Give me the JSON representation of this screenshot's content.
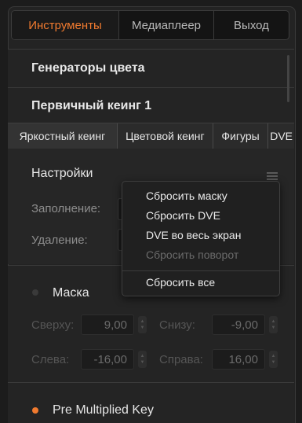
{
  "tabs": [
    "Инструменты",
    "Медиаплеер",
    "Выход"
  ],
  "sections": {
    "color_generators": "Генераторы цвета",
    "upstream_key": "Первичный кеинг 1"
  },
  "key_tabs": [
    "Яркостный кеинг",
    "Цветовой кеинг",
    "Фигуры",
    "DVE"
  ],
  "settings": {
    "title": "Настройки",
    "fill_label": "Заполнение:",
    "key_label": "Удаление:"
  },
  "mask": {
    "label": "Маска",
    "top_label": "Сверху:",
    "top_value": "9,00",
    "bottom_label": "Снизу:",
    "bottom_value": "-9,00",
    "left_label": "Слева:",
    "left_value": "-16,00",
    "right_label": "Справа:",
    "right_value": "16,00"
  },
  "pre_multiplied_key": "Pre Multiplied Key",
  "context_menu": {
    "items": [
      "Сбросить маску",
      "Сбросить DVE",
      "DVE во весь экран",
      "Сбросить поворот",
      "Сбросить все"
    ]
  },
  "colors": {
    "accent": "#f07a2f",
    "background": "#232323"
  }
}
